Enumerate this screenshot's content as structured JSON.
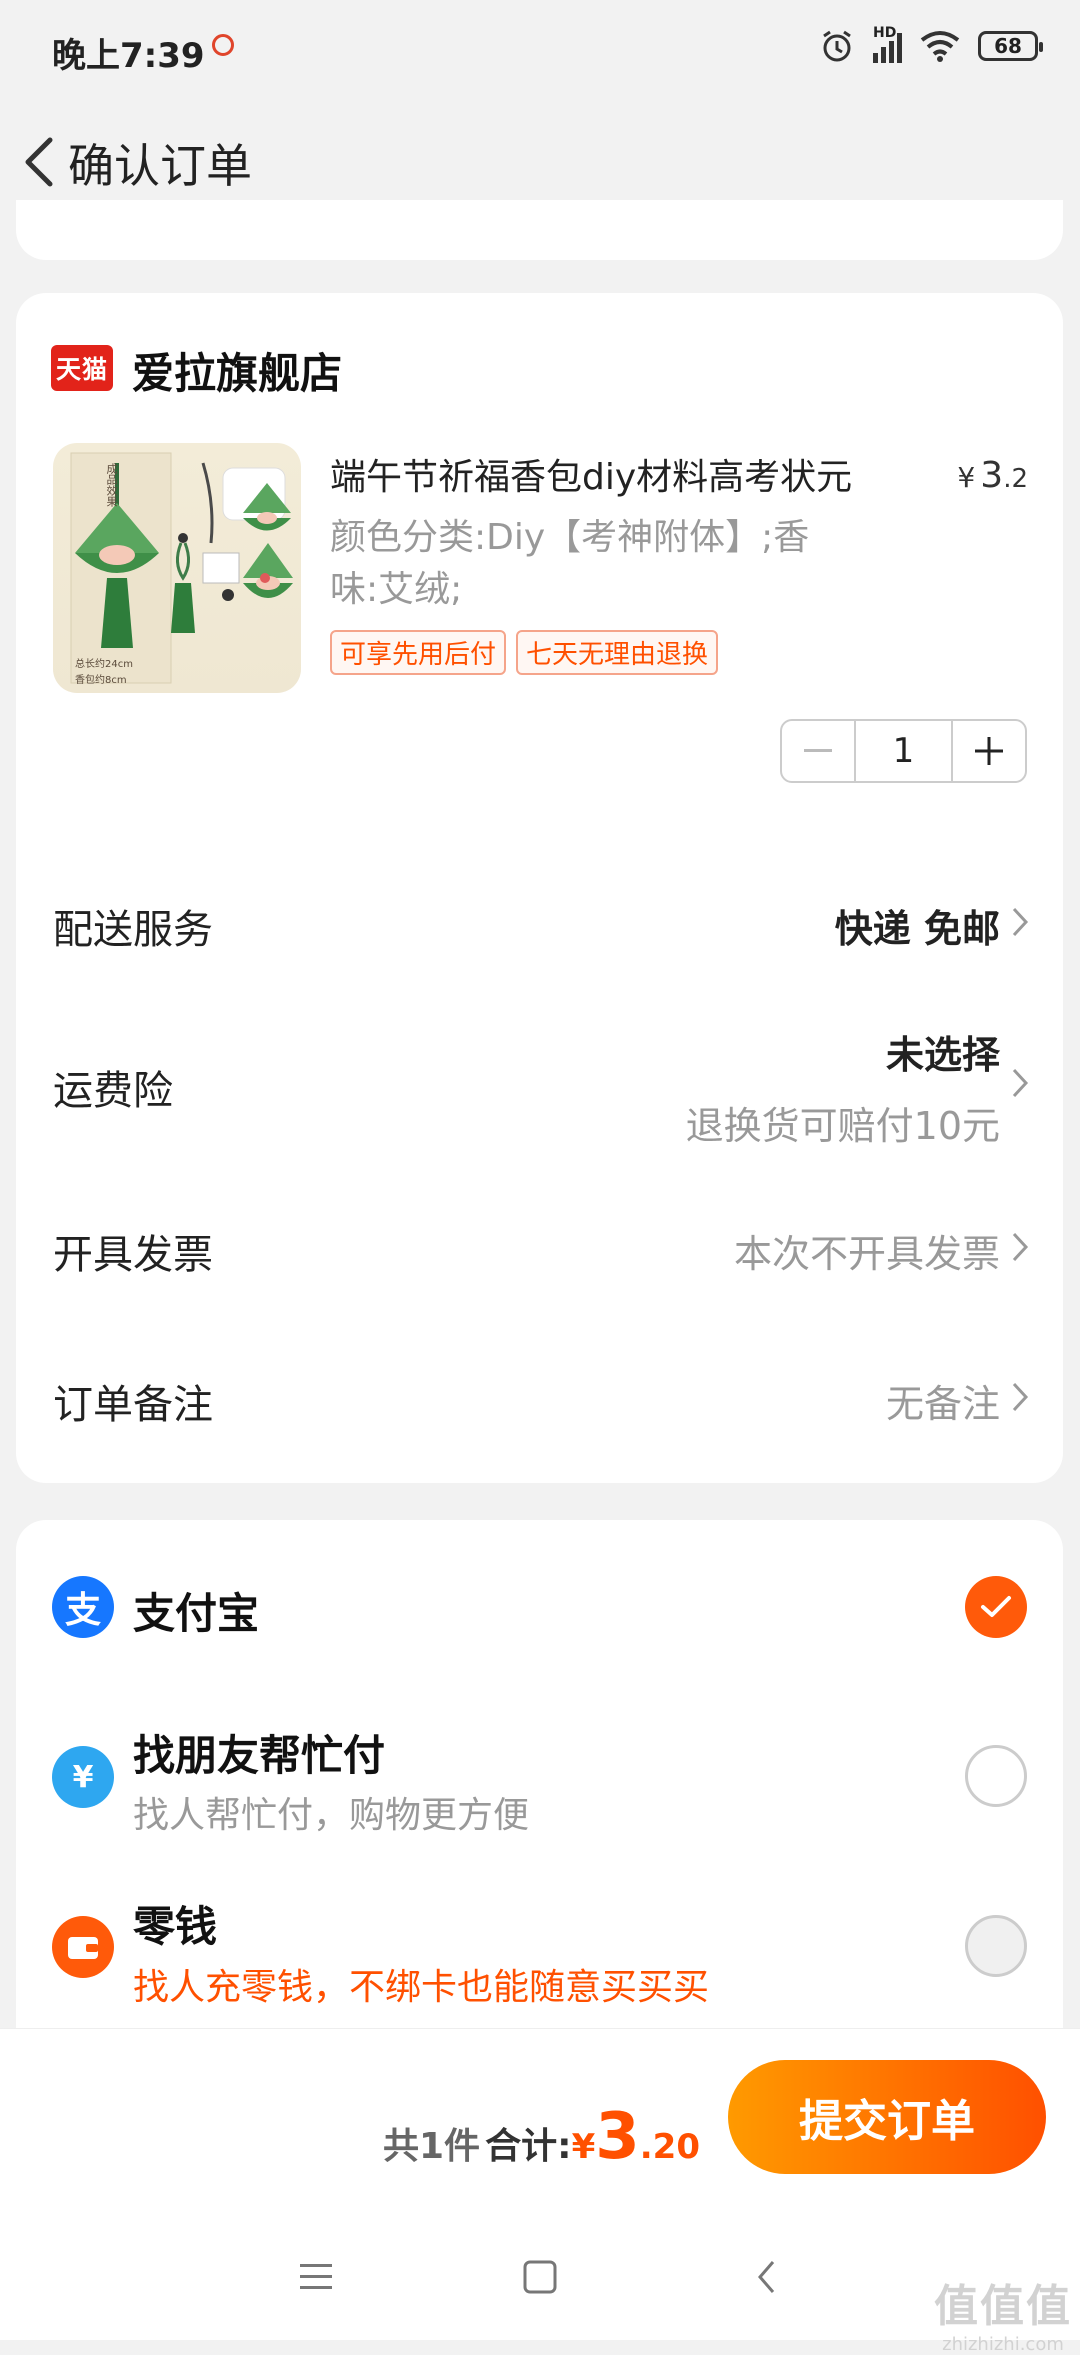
{
  "status_bar": {
    "time": "晚上7:39",
    "network": "HD",
    "battery": "68",
    "icons": [
      "alarm-icon",
      "signal-icon",
      "wifi-icon",
      "battery-icon"
    ]
  },
  "header": {
    "title": "确认订单"
  },
  "shop": {
    "badge": "天猫",
    "name": "爱拉旗舰店"
  },
  "product": {
    "title": "端午节祈福香包diy材料高考状元",
    "price_currency": "¥",
    "price_int": "3",
    "price_dec": ".2",
    "spec": "颜色分类:Diy【考神附体】;香味:艾绒;",
    "tags": [
      "可享先用后付",
      "七天无理由退换"
    ],
    "quantity": "1",
    "image_caption": [
      "成品效果",
      "总长约24cm",
      "香包约8cm"
    ]
  },
  "rows": {
    "delivery": {
      "label": "配送服务",
      "value": "快递 免邮"
    },
    "insurance": {
      "label": "运费险",
      "value": "未选择",
      "sub": "退换货可赔付10元"
    },
    "invoice": {
      "label": "开具发票",
      "value": "本次不开具发票"
    },
    "remark": {
      "label": "订单备注",
      "value": "无备注"
    }
  },
  "payment": {
    "alipay": {
      "icon_glyph": "支",
      "name": "支付宝",
      "selected": true
    },
    "friend": {
      "icon_glyph": "¥",
      "name": "找朋友帮忙付",
      "sub": "找人帮忙付，购物更方便",
      "selected": false
    },
    "change": {
      "name": "零钱",
      "sub": "找人充零钱，不绑卡也能随意买买买",
      "selected": false
    }
  },
  "footer": {
    "count": "共1件",
    "total_label": "合计:",
    "total_currency": "¥",
    "total_int": "3",
    "total_dec": ".20",
    "submit": "提交订单"
  },
  "watermark": {
    "main": "值值值",
    "sub": "zhizhizhi.com"
  },
  "colors": {
    "accent": "#ff5000",
    "alipay_blue": "#1677ff",
    "tmall_red": "#e2231a"
  }
}
